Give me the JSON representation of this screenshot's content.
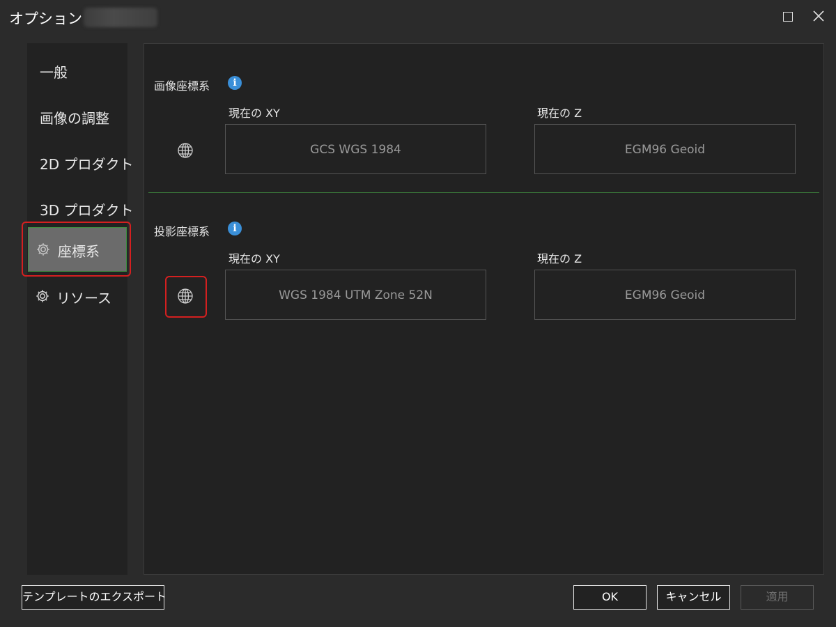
{
  "window": {
    "title": "オプション -",
    "maximize_icon": "maximize-icon",
    "close_icon": "close-icon"
  },
  "sidebar": {
    "items": [
      {
        "label": "一般",
        "icon": null,
        "active": false
      },
      {
        "label": "画像の調整",
        "icon": null,
        "active": false
      },
      {
        "label": "2D プロダクト",
        "icon": null,
        "active": false
      },
      {
        "label": "3D プロダクト",
        "icon": null,
        "active": false
      },
      {
        "label": "座標系",
        "icon": "gear-icon",
        "active": true
      },
      {
        "label": "リソース",
        "icon": "gear-icon",
        "active": false
      }
    ]
  },
  "image_crs": {
    "title": "画像座標系",
    "xy_label": "現在の XY",
    "z_label": "現在の Z",
    "xy_value": "GCS WGS 1984",
    "z_value": "EGM96 Geoid"
  },
  "projected_crs": {
    "title": "投影座標系",
    "xy_label": "現在の XY",
    "z_label": "現在の Z",
    "xy_value": "WGS 1984 UTM Zone 52N",
    "z_value": "EGM96 Geoid"
  },
  "footer": {
    "export_label": "テンプレートのエクスポート",
    "ok_label": "OK",
    "cancel_label": "キャンセル",
    "apply_label": "適用"
  },
  "colors": {
    "accent_green": "#3b7a3b",
    "highlight_red": "#d42020",
    "info_blue": "#3a8fd8",
    "active_item_bg": "#6b6b6b"
  }
}
